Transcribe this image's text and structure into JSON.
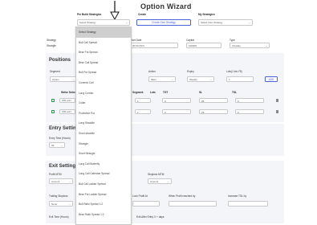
{
  "page": {
    "title": "Option Wizard"
  },
  "header": {
    "prebuilt_label": "Pre Build Strategies",
    "prebuilt_value": "Select Strategy",
    "create_label": "Create",
    "create_button": "Create Own Strategy",
    "my_label": "My Strategies",
    "my_value": "Select Own Strategy"
  },
  "strategy_row": {
    "strategy_label": "Strategy",
    "strategy_value": "Strangle",
    "date_label": "Start Date",
    "date_value": "00:00 (IST)",
    "capital_label": "Capital",
    "capital_value": "100000",
    "type_label": "Type",
    "type_value": "Intraday"
  },
  "positions": {
    "heading": "Positions",
    "segment_label": "Segment",
    "segment_value": "Option",
    "action_label": "Action",
    "action_value": "SELL",
    "expiry_label": "Expiry",
    "expiry_value": "Weekly",
    "lots_label": "Lots(1 lot=75)",
    "lots_value": "1",
    "add_button": "ADD",
    "columns": {
      "strike": "Strike Selection",
      "segment": "Segment",
      "lots": "Lots",
      "tgt": "TGT",
      "sl": "SL",
      "tsl": "TSL"
    },
    "rows": [
      {
        "strike": "ATM point",
        "qty": "1",
        "tgt": "0",
        "sl": "25",
        "tsl": "0"
      },
      {
        "strike": "ATM point",
        "qty": "1",
        "tgt": "0",
        "sl": "25",
        "tsl": "0"
      }
    ]
  },
  "entry": {
    "heading": "Entry Setting",
    "time_label": "Entry Time (Hours)",
    "time_value": "09"
  },
  "exit": {
    "heading": "Exit Setting",
    "profit_label": "Profit MTM",
    "profit_value": "Amount",
    "stoploss_label": "Stoploss MTM",
    "stoploss_value": "Amount",
    "trailing_label": "Trailing Stoploss",
    "trailing_value": "None",
    "lock_label": "Lock Profit At",
    "when_label": "When Profit reached by",
    "increase_label": "Increase TSL by",
    "exit_time_label": "Exit Time (Hours)",
    "exit_after_label": "Exit After Entry X + days"
  },
  "dropdown": {
    "items": [
      "Select Strategy",
      "Bull Call Spread",
      "Bear Put Spread",
      "Bear Call Spread",
      "Bull Put Spread",
      "Covered Call",
      "Long Combo",
      "Collar",
      "Protective Put",
      "Long Straddle",
      "Short straddle",
      "Strangle",
      "Short Strangle",
      "Long Call Butterfly",
      "Long Call Calendar Spread",
      "Bull Call Ladder Spread",
      "Bear Put Ladder Spread",
      "Bull Ratio Spread 1:2",
      "Bear Ratio Spread 1:2"
    ],
    "selected_index": 0
  },
  "colors": {
    "accent": "#4a63d8",
    "checkbox": "#2a9d4a",
    "selected_bg": "#cfcfcf",
    "panel_bg": "#f4f5f8"
  }
}
